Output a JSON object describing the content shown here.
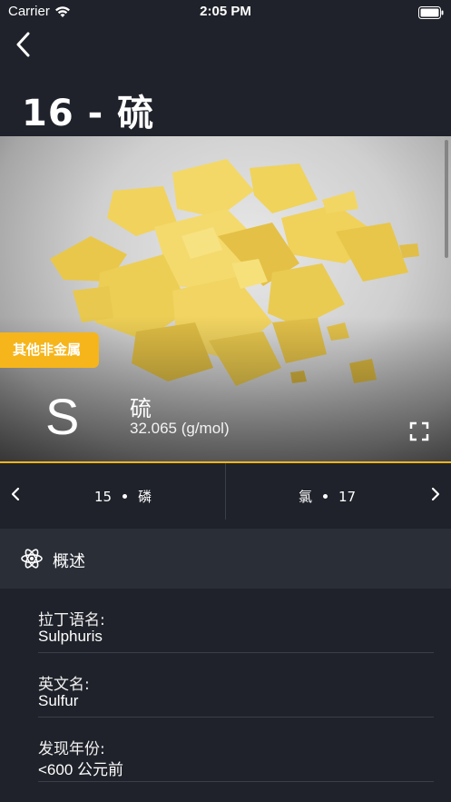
{
  "status_bar": {
    "carrier": "Carrier",
    "time": "2:05 PM"
  },
  "header": {
    "title": "16 - 硫"
  },
  "element": {
    "category": "其他非金属",
    "symbol": "S",
    "name": "硫",
    "mass": "32.065 (g/mol)"
  },
  "nav": {
    "prev": {
      "number": "15",
      "name": "磷"
    },
    "next": {
      "name": "氯",
      "number": "17"
    }
  },
  "section": {
    "title": "概述"
  },
  "info": [
    {
      "label": "拉丁语名:",
      "value": "Sulphuris"
    },
    {
      "label": "英文名:",
      "value": "Sulfur"
    },
    {
      "label": "发现年份:",
      "value": "<600 公元前"
    }
  ],
  "colors": {
    "accent": "#f5b51b",
    "background": "#1f222a",
    "section": "#2a2e37"
  }
}
